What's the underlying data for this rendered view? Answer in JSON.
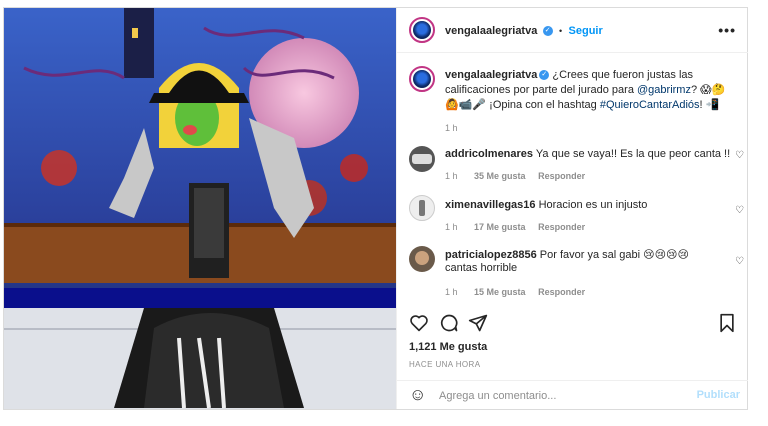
{
  "post": {
    "author": "vengalaalegriatva",
    "follow_label": "Seguir",
    "more_label": "•••",
    "separator": "•",
    "verified_mark": "✓",
    "caption": {
      "text_a": "¿Crees que fueron justas las calificaciones por parte del jurado para ",
      "mention": "@gabrirmz",
      "emojis_a": "? 😱🤔🙆📹🎤",
      "text_b": " ¡Opina con el hashtag ",
      "hashtag": "#QuieroCantarAdiós",
      "emojis_b": "! 📲",
      "time": "1 h"
    },
    "comments": [
      {
        "user": "addricolmenares",
        "text": "Ya que se vaya!! Es la que peor canta !!",
        "time": "1 h",
        "likes": "35 Me gusta",
        "reply": "Responder"
      },
      {
        "user": "ximenavillegas16",
        "text": "Horacion es un injusto",
        "time": "1 h",
        "likes": "17 Me gusta",
        "reply": "Responder"
      },
      {
        "user": "patricialopez8856",
        "text": "Por favor ya sal gabi 😢😢😢😢cantas horrible",
        "time": "1 h",
        "likes": "15 Me gusta",
        "reply": "Responder"
      }
    ],
    "likes_count": "1,121 Me gusta",
    "posted_time": "HACE UNA HORA",
    "add_comment": {
      "emoji": "☺",
      "placeholder": "Agrega un comentario...",
      "publish_label": "Publicar"
    },
    "icons": {
      "like": "heart-outline-icon",
      "comment": "comment-bubble-icon",
      "share": "paper-plane-icon",
      "save": "bookmark-icon",
      "comment_like": "small-heart-icon"
    }
  },
  "colors": {
    "link_blue": "#0095f6",
    "mention": "#00376b",
    "verified": "#3897f0",
    "muted": "#8e8e8e"
  }
}
